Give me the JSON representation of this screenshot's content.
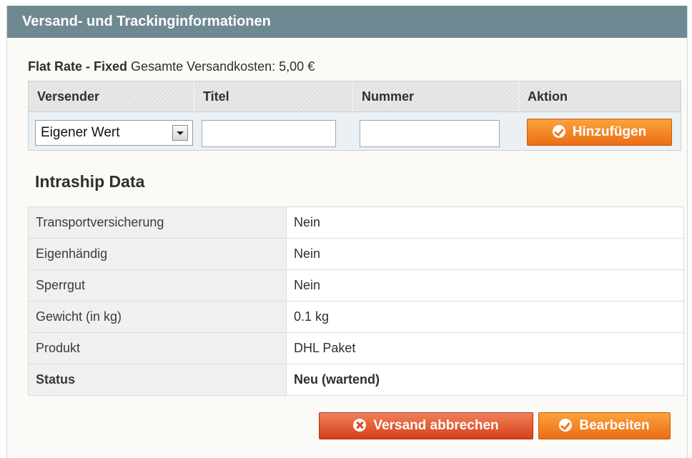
{
  "header": {
    "title": "Versand- und Trackinginformationen"
  },
  "shipping": {
    "method": "Flat Rate - Fixed",
    "cost_text": "Gesamte Versandkosten: 5,00 €"
  },
  "tracking": {
    "columns": [
      "Versender",
      "Titel",
      "Nummer",
      "Aktion"
    ],
    "carrier_selected": "Eigener Wert",
    "title_value": "",
    "number_value": "",
    "add_label": "Hinzufügen"
  },
  "intraship": {
    "title": "Intraship Data",
    "rows": [
      {
        "label": "Transportversicherung",
        "value": "Nein"
      },
      {
        "label": "Eigenhändig",
        "value": "Nein"
      },
      {
        "label": "Sperrgut",
        "value": "Nein"
      },
      {
        "label": "Gewicht (in kg)",
        "value": "0.1 kg"
      },
      {
        "label": "Produkt",
        "value": "DHL Paket"
      },
      {
        "label": "Status",
        "value": "Neu (wartend)"
      }
    ]
  },
  "actions": {
    "cancel_label": "Versand abbrechen",
    "edit_label": "Bearbeiten"
  },
  "colors": {
    "header_bg": "#6f8992",
    "button_orange": "#ec6d15",
    "button_red": "#d63f19"
  }
}
